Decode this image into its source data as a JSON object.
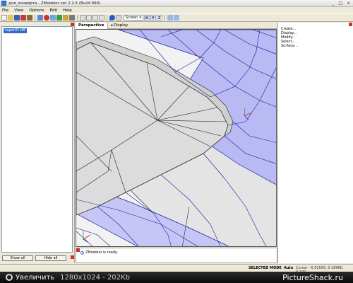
{
  "window": {
    "title": "для_конверта - ZModeler ver 2.2.5 (Build 990)",
    "controls": {
      "minimize": "_",
      "maximize": "□",
      "close": "x"
    }
  },
  "menu": [
    "File",
    "View",
    "Options",
    "Edit",
    "Help"
  ],
  "toolbar": {
    "screen_mode": "Screen",
    "axes": [
      "X",
      "Y",
      "Z"
    ]
  },
  "scene": {
    "items": [
      "super01.dff"
    ],
    "show_all": "Show all",
    "hide_all": "Hide all"
  },
  "viewport": {
    "active_tab": "Perspective",
    "display_tab": "Display"
  },
  "commands": [
    "Create...",
    "Display...",
    "Modify...",
    "Select...",
    "Surface..."
  ],
  "status": {
    "message": "ZModeler is ready.",
    "mode": "SELECTED MODE",
    "auto": "Auto",
    "cursor": "Cursor: -0.01505, 0.18960, 0.100"
  },
  "watermark": {
    "zoom_label": "Увеличить",
    "size": "1280x1024 - 202Kb",
    "brand": "PictureShack.ru"
  },
  "colors": {
    "selection": "#8c8cff",
    "wire": "#1a1aa0",
    "surface": "#d8d8d8",
    "accent": "#316ac5"
  }
}
